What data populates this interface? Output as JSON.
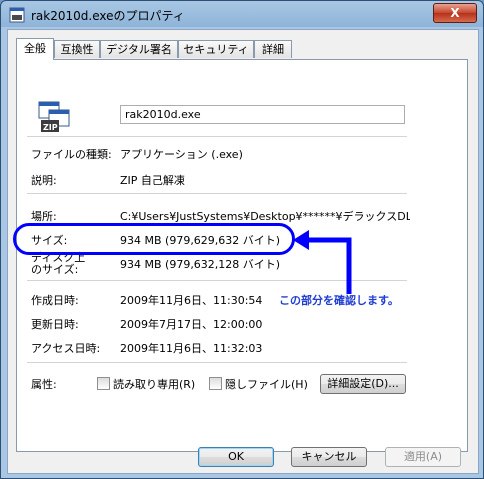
{
  "window": {
    "title": "rak2010d.exeのプロパティ",
    "close_label": "X"
  },
  "tabs": [
    {
      "label": "全般",
      "active": true
    },
    {
      "label": "互換性",
      "active": false
    },
    {
      "label": "デジタル署名",
      "active": false
    },
    {
      "label": "セキュリティ",
      "active": false
    },
    {
      "label": "詳細",
      "active": false
    }
  ],
  "file": {
    "icon": "zip-archive-icon",
    "name": "rak2010d.exe"
  },
  "fields": {
    "type_label": "ファイルの種類:",
    "type_value": "アプリケーション (.exe)",
    "desc_label": "説明:",
    "desc_value": "ZIP 自己解凍",
    "location_label": "場所:",
    "location_value": "C:¥Users¥JustSystems¥Desktop¥******¥デラックスDL版",
    "size_label": "サイズ:",
    "size_value": "934 MB (979,629,632 バイト)",
    "disksize_label_1": "ディスク上",
    "disksize_label_2": "のサイズ:",
    "disksize_value": "934 MB (979,632,128 バイト)",
    "created_label": "作成日時:",
    "created_value": "2009年11月6日、11:30:54",
    "modified_label": "更新日時:",
    "modified_value": "2009年7月17日、12:00:00",
    "accessed_label": "アクセス日時:",
    "accessed_value": "2009年11月6日、11:32:03",
    "attrib_label": "属性:"
  },
  "attributes": {
    "readonly_label": "読み取り専用(R)",
    "readonly_checked": false,
    "hidden_label": "隠しファイル(H)",
    "hidden_checked": false,
    "advanced_button": "詳細設定(D)..."
  },
  "annotation": {
    "text": "この部分を確認します。",
    "color": "#1f3dd0"
  },
  "buttons": {
    "ok": "OK",
    "cancel": "キャンセル",
    "apply": "適用(A)"
  },
  "colors": {
    "highlight": "#0000ff",
    "title_bar": "#a9c7e4",
    "close_button": "#c5452d"
  }
}
